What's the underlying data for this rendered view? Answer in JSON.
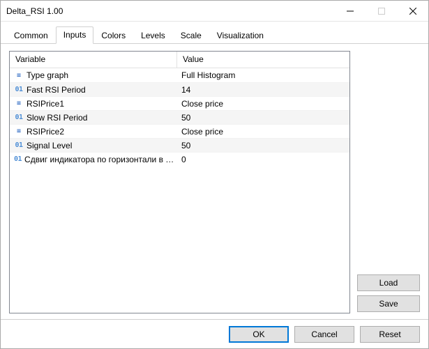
{
  "window": {
    "title": "Delta_RSI 1.00"
  },
  "tabs": [
    {
      "label": "Common"
    },
    {
      "label": "Inputs"
    },
    {
      "label": "Colors"
    },
    {
      "label": "Levels"
    },
    {
      "label": "Scale"
    },
    {
      "label": "Visualization"
    }
  ],
  "active_tab_index": 1,
  "grid": {
    "headers": {
      "variable": "Variable",
      "value": "Value"
    },
    "rows": [
      {
        "type": "enum",
        "icon": "≡",
        "variable": "Type graph",
        "value": "Full Histogram"
      },
      {
        "type": "int",
        "icon": "01",
        "variable": "Fast RSI Period",
        "value": "14"
      },
      {
        "type": "enum",
        "icon": "≡",
        "variable": "RSIPrice1",
        "value": "Close price"
      },
      {
        "type": "int",
        "icon": "01",
        "variable": "Slow RSI Period",
        "value": "50"
      },
      {
        "type": "enum",
        "icon": "≡",
        "variable": "RSIPrice2",
        "value": "Close price"
      },
      {
        "type": "int",
        "icon": "01",
        "variable": "Signal Level",
        "value": "50"
      },
      {
        "type": "int",
        "icon": "01",
        "variable": "Сдвиг индикатора по горизонтали в …",
        "value": "0"
      }
    ]
  },
  "side_buttons": {
    "load": "Load",
    "save": "Save"
  },
  "footer_buttons": {
    "ok": "OK",
    "cancel": "Cancel",
    "reset": "Reset"
  }
}
